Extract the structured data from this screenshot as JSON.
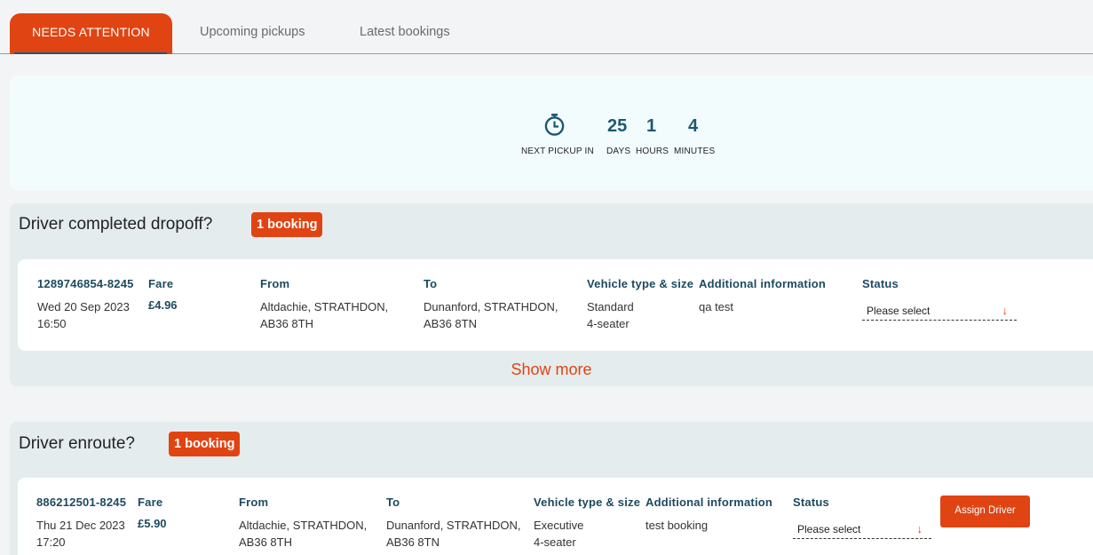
{
  "tabs": [
    {
      "label": "NEEDS ATTENTION",
      "active": true
    },
    {
      "label": "Upcoming pickups",
      "active": false
    },
    {
      "label": "Latest bookings",
      "active": false
    }
  ],
  "countdown": {
    "icon": "stopwatch-icon",
    "label": "NEXT PICKUP IN",
    "days": "25",
    "days_label": "DAYS",
    "hours": "1",
    "hours_label": "HOURS",
    "minutes": "4",
    "minutes_label": "MINUTES"
  },
  "columns": {
    "fare": "Fare",
    "from": "From",
    "to": "To",
    "vehicle": "Vehicle type & size",
    "info": "Additional information",
    "status": "Status"
  },
  "sections": [
    {
      "title": "Driver completed dropoff?",
      "badge": "1 booking",
      "booking": {
        "id": "1289746854-8245",
        "date": "Wed 20 Sep 2023",
        "time": "16:50",
        "fare": "£4.96",
        "from_1": "Altdachie, STRATHDON,",
        "from_2": "AB36 8TH",
        "to_1": "Dunanford, STRATHDON,",
        "to_2": "AB36 8TN",
        "vehicle_1": "Standard",
        "vehicle_2": "4-seater",
        "info": "qa test",
        "status_placeholder": "Please select"
      },
      "show_more": "Show more"
    },
    {
      "title": "Driver enroute?",
      "badge": "1 booking",
      "booking": {
        "id": "886212501-8245",
        "date": "Thu 21 Dec 2023",
        "time": "17:20",
        "fare": "£5.90",
        "from_1": "Altdachie, STRATHDON,",
        "from_2": "AB36 8TH",
        "to_1": "Dunanford, STRATHDON,",
        "to_2": "AB36 8TN",
        "vehicle_1": "Executive",
        "vehicle_2": "4-seater",
        "info": "test booking",
        "status_placeholder": "Please select",
        "action": "Assign Driver"
      }
    }
  ],
  "colors": {
    "accent": "#e04412",
    "heading": "#1c4a5f",
    "countdown_bg": "#f3fcfd",
    "section_bg": "#e5ecee"
  }
}
